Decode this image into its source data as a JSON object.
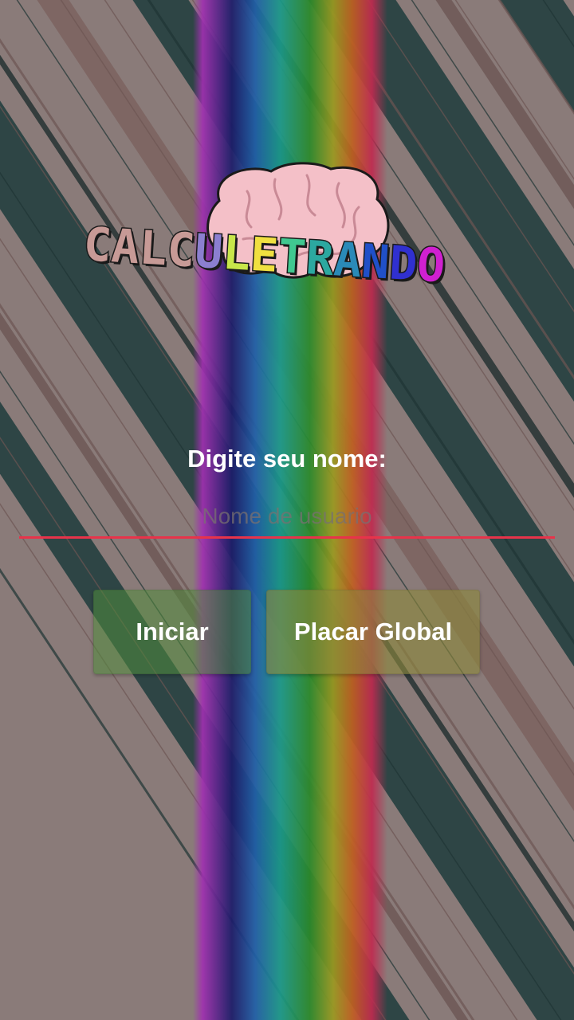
{
  "app": {
    "logo_text": "CALCULETRANDO",
    "logo_letters": [
      {
        "ch": "C",
        "color": "#c79a96"
      },
      {
        "ch": "A",
        "color": "#c79a96"
      },
      {
        "ch": "L",
        "color": "#c79a96"
      },
      {
        "ch": "C",
        "color": "#c79a96"
      },
      {
        "ch": "U",
        "color": "#8b7fd0"
      },
      {
        "ch": "L",
        "color": "#c8e64a"
      },
      {
        "ch": "E",
        "color": "#f0e040"
      },
      {
        "ch": "T",
        "color": "#40c890"
      },
      {
        "ch": "R",
        "color": "#2ca8a0"
      },
      {
        "ch": "A",
        "color": "#2a8ab8"
      },
      {
        "ch": "N",
        "color": "#2050c8"
      },
      {
        "ch": "D",
        "color": "#3030d0"
      },
      {
        "ch": "O",
        "color": "#d020d0"
      }
    ],
    "brain_icon": "brain-icon"
  },
  "form": {
    "prompt": "Digite seu nome:",
    "input_value": "",
    "input_placeholder": "Nome de usuario",
    "accent_color": "#e8334a"
  },
  "buttons": {
    "start_label": "Iniciar",
    "scoreboard_label": "Placar Global"
  }
}
